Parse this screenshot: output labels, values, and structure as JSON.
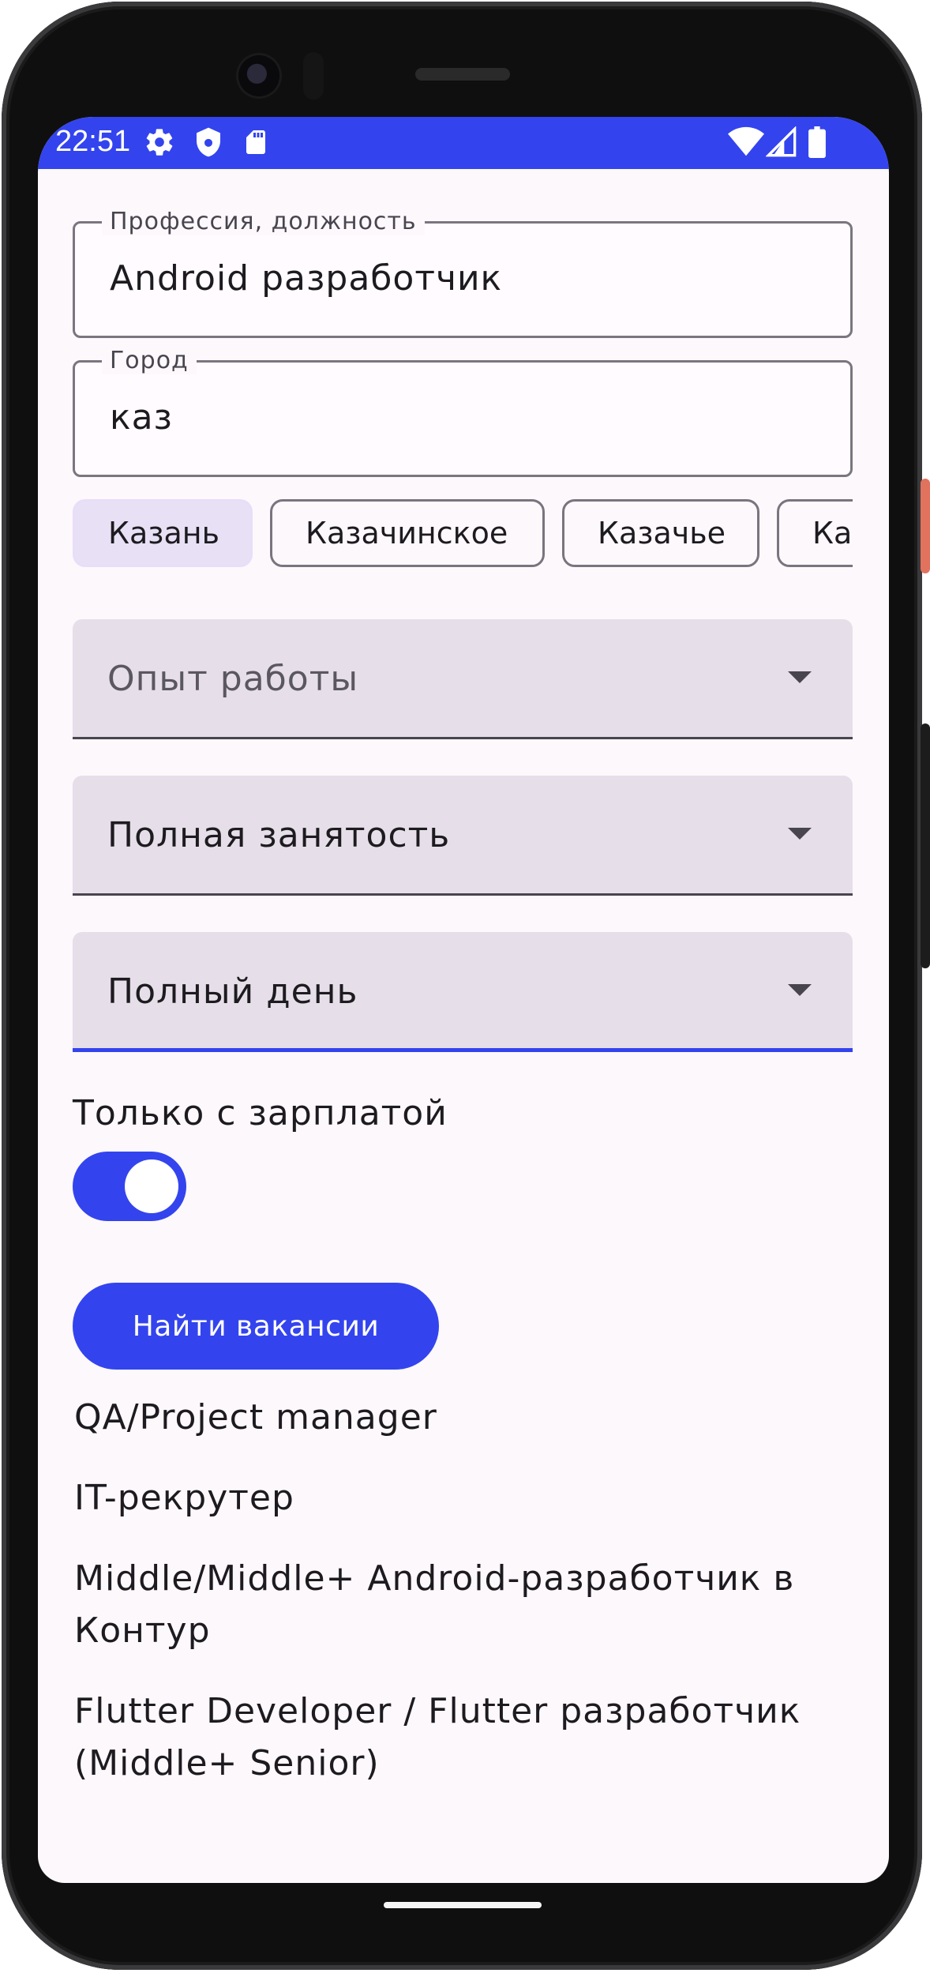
{
  "status_bar": {
    "time": "22:51",
    "left_icons": [
      "gear-icon",
      "shield-icon",
      "sd-card-icon"
    ],
    "right_icons": [
      "wifi-icon",
      "signal-icon",
      "battery-icon"
    ],
    "color": "#3344ee"
  },
  "profession_field": {
    "label": "Профессия, должность",
    "value": "Android разработчик"
  },
  "city_field": {
    "label": "Город",
    "value": "каз"
  },
  "city_suggestions": [
    {
      "label": "Казань",
      "selected": true
    },
    {
      "label": "Казачинское",
      "selected": false
    },
    {
      "label": "Казачье",
      "selected": false
    },
    {
      "label": "Ка",
      "selected": false
    }
  ],
  "experience_dropdown": {
    "placeholder": "Опыт работы"
  },
  "employment_dropdown": {
    "value": "Полная занятость"
  },
  "schedule_dropdown": {
    "value": "Полный день"
  },
  "salary_switch": {
    "label": "Только с зарплатой",
    "on": true
  },
  "search_button": {
    "label": "Найти вакансии"
  },
  "results": [
    "QA/Project manager",
    "IT-рекрутер",
    "Middle/Middle+ Android-разработчик в Контур",
    "Flutter Developer / Flutter разработчик (Middle+ Senior)"
  ],
  "colors": {
    "accent": "#3344ee",
    "screen_bg": "#fdf8fc",
    "dropdown_bg": "#e6dfe9",
    "chip_selected_bg": "#e8e1f5",
    "phone_frame": "#0f0f10"
  }
}
